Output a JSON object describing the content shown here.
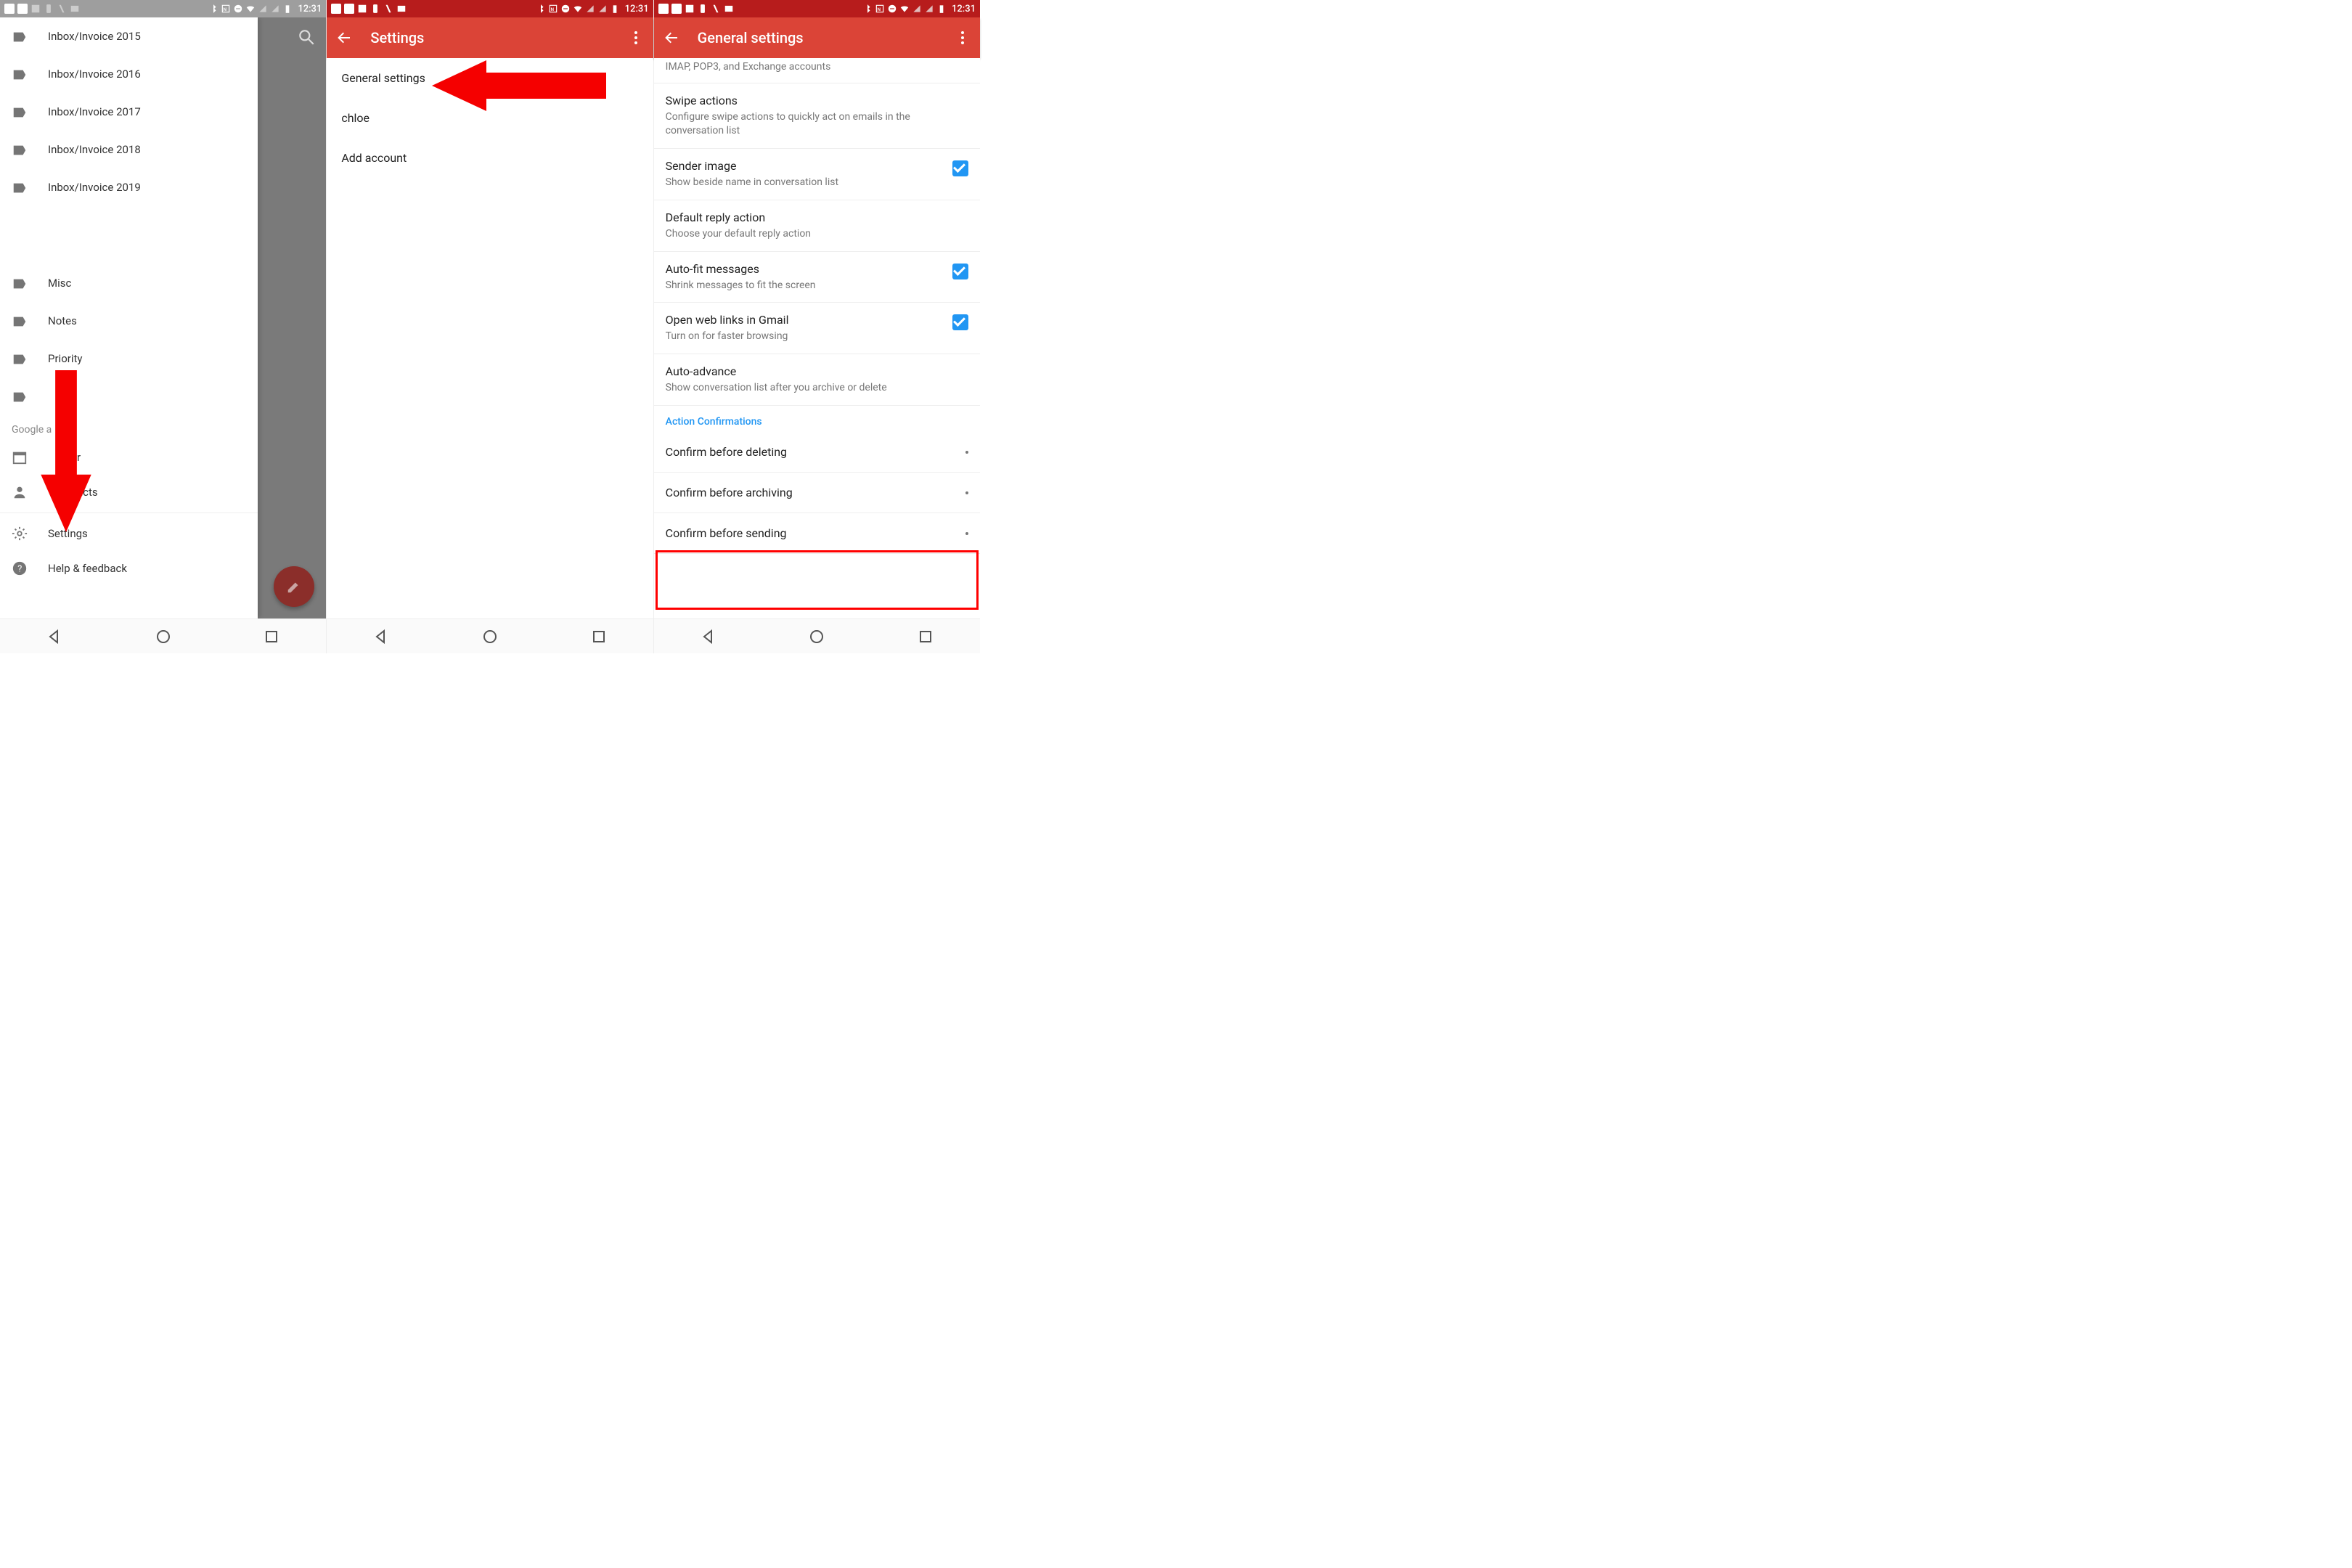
{
  "status_time": "12:31",
  "screen1": {
    "labels": [
      "Inbox/Invoice 2015",
      "Inbox/Invoice 2016",
      "Inbox/Invoice 2017",
      "Inbox/Invoice 2018",
      "Inbox/Invoice 2019"
    ],
    "labels2": [
      "Misc",
      "Notes",
      "Priority",
      ""
    ],
    "google_apps_heading": "Google a",
    "apps": [
      "r",
      "acts"
    ],
    "bottom": [
      "Settings",
      "Help & feedback"
    ]
  },
  "screen2": {
    "title": "Settings",
    "items": [
      "General settings",
      "chloe",
      "Add account"
    ]
  },
  "screen3": {
    "title": "General settings",
    "toptext": "IMAP, POP3, and Exchange accounts",
    "settings": [
      {
        "title": "Swipe actions",
        "sub": "Configure swipe actions to quickly act on emails in the conversation list",
        "cb": null
      },
      {
        "title": "Sender image",
        "sub": "Show beside name in conversation list",
        "cb": true
      },
      {
        "title": "Default reply action",
        "sub": "Choose your default reply action",
        "cb": null
      },
      {
        "title": "Auto-fit messages",
        "sub": "Shrink messages to fit the screen",
        "cb": true
      },
      {
        "title": "Open web links in Gmail",
        "sub": "Turn on for faster browsing",
        "cb": true
      },
      {
        "title": "Auto-advance",
        "sub": "Show conversation list after you archive or delete",
        "cb": null
      }
    ],
    "section": "Action Confirmations",
    "confirms": [
      {
        "label": "Confirm before deleting",
        "cb": false
      },
      {
        "label": "Confirm before archiving",
        "cb": false
      },
      {
        "label": "Confirm before sending",
        "cb": false
      }
    ]
  }
}
